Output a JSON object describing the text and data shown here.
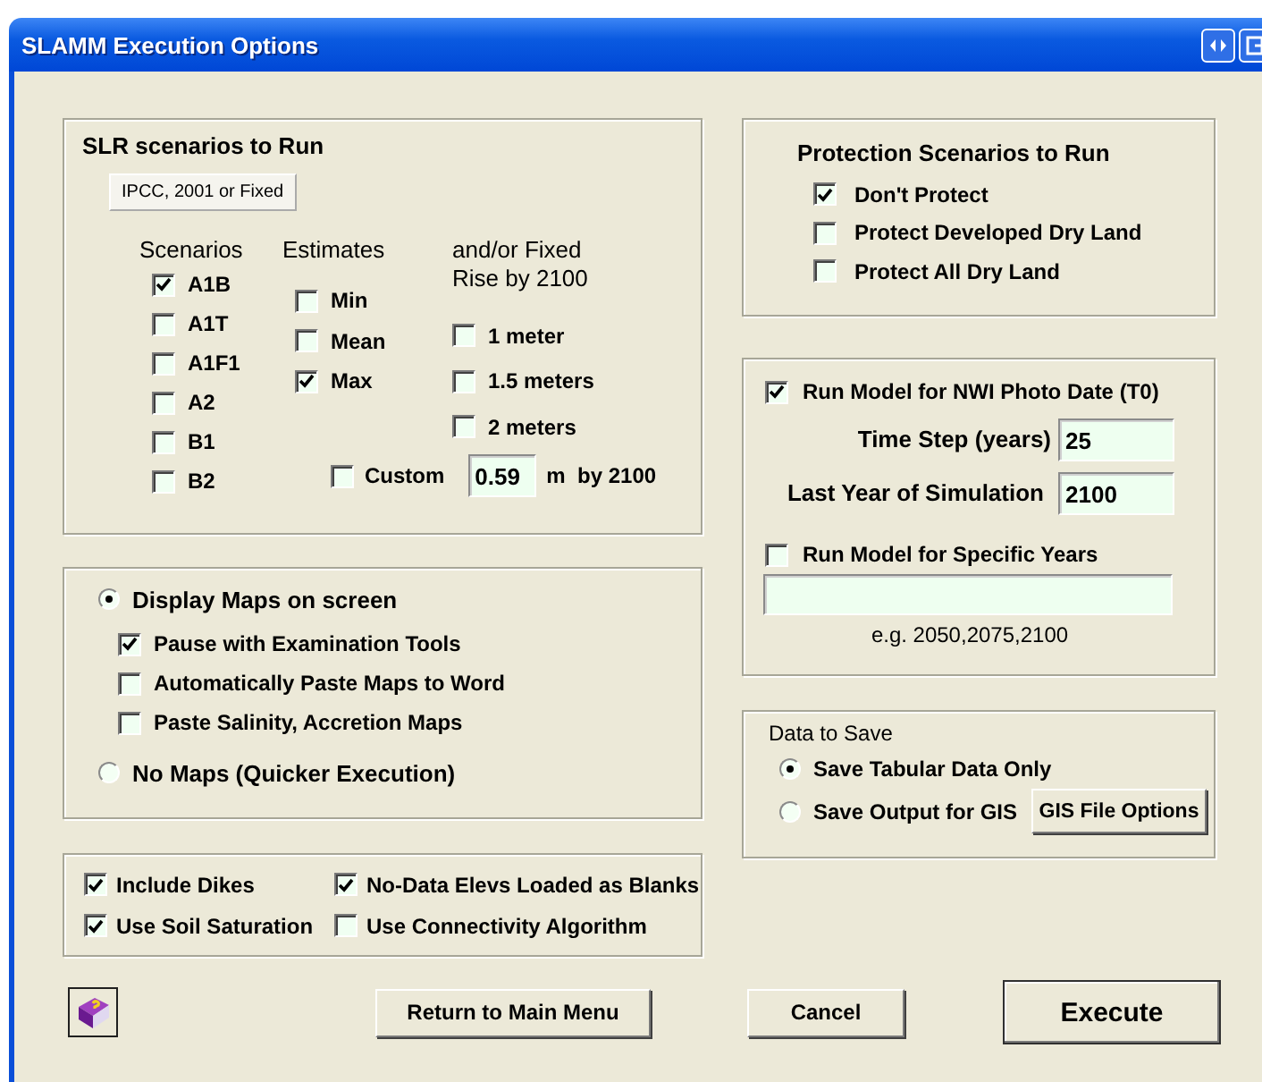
{
  "window": {
    "title": "SLAMM Execution Options"
  },
  "slr": {
    "title": "SLR scenarios to Run",
    "tab": "IPCC, 2001 or Fixed",
    "scenarios": {
      "header": "Scenarios",
      "items": [
        {
          "label": "A1B",
          "checked": true
        },
        {
          "label": "A1T",
          "checked": false
        },
        {
          "label": "A1F1",
          "checked": false
        },
        {
          "label": "A2",
          "checked": false
        },
        {
          "label": "B1",
          "checked": false
        },
        {
          "label": "B2",
          "checked": false
        }
      ]
    },
    "estimates": {
      "header": "Estimates",
      "items": [
        {
          "label": "Min",
          "checked": false
        },
        {
          "label": "Mean",
          "checked": false
        },
        {
          "label": "Max",
          "checked": true
        }
      ]
    },
    "fixed": {
      "header_lines": [
        "and/or Fixed",
        "Rise by 2100"
      ],
      "items": [
        {
          "label": "1 meter",
          "checked": false
        },
        {
          "label": "1.5 meters",
          "checked": false
        },
        {
          "label": "2 meters",
          "checked": false
        }
      ]
    },
    "custom": {
      "label": "Custom",
      "checked": false,
      "value": "0.59",
      "unit": "m  by 2100"
    }
  },
  "map_modes": [
    {
      "label": "Display Maps on screen",
      "selected": true
    },
    {
      "label": "No Maps (Quicker Execution)",
      "selected": false
    }
  ],
  "map_options": [
    {
      "label": "Pause with Examination Tools",
      "checked": true
    },
    {
      "label": "Automatically Paste Maps to Word",
      "checked": false
    },
    {
      "label": "Paste Salinity, Accretion Maps",
      "checked": false
    }
  ],
  "flags": [
    {
      "label": "Include Dikes",
      "checked": true
    },
    {
      "label": "No-Data Elevs Loaded as Blanks",
      "checked": true
    },
    {
      "label": "Use Soil Saturation",
      "checked": true
    },
    {
      "label": "Use Connectivity Algorithm",
      "checked": false
    }
  ],
  "protection": {
    "title": "Protection Scenarios to Run",
    "items": [
      {
        "label": "Don't Protect",
        "checked": true
      },
      {
        "label": "Protect Developed Dry Land",
        "checked": false
      },
      {
        "label": "Protect All Dry Land",
        "checked": false
      }
    ]
  },
  "run_model": {
    "t0": {
      "label": "Run Model for NWI Photo Date (T0)",
      "checked": true
    },
    "time_step": {
      "label": "Time Step (years)",
      "value": "25"
    },
    "last_year": {
      "label": "Last Year of Simulation",
      "value": "2100"
    },
    "specific": {
      "label": "Run Model for Specific Years",
      "checked": false
    },
    "hint": "e.g. 2050,2075,2100"
  },
  "data_to_save": {
    "title": "Data to Save",
    "options": [
      {
        "label": "Save Tabular Data Only",
        "selected": true
      },
      {
        "label": "Save Output for GIS",
        "selected": false
      }
    ],
    "gis_button": "GIS File Options"
  },
  "buttons": [
    {
      "label": "Return to Main Menu",
      "kind": "normal"
    },
    {
      "label": "Cancel",
      "kind": "normal"
    },
    {
      "label": "Execute",
      "kind": "default"
    }
  ]
}
